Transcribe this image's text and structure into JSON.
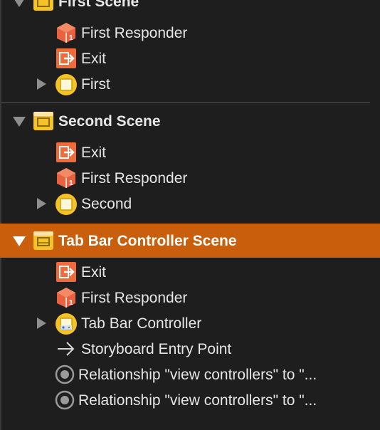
{
  "scenes": [
    {
      "title": "First Scene",
      "items": [
        "First Responder",
        "Exit",
        "First"
      ]
    },
    {
      "title": "Second Scene",
      "items": [
        "Exit",
        "First Responder",
        "Second"
      ]
    },
    {
      "title": "Tab Bar Controller Scene",
      "items": [
        "Exit",
        "First Responder",
        "Tab Bar Controller",
        "Storyboard Entry Point",
        "Relationship \"view controllers\" to \"...",
        "Relationship \"view controllers\" to \"..."
      ]
    }
  ],
  "colors": {
    "background": "#1e1e1e",
    "selected_row": "#c95f0c",
    "scene_icon_yellow": "#f5c228",
    "exit_icon_orange": "#f06b3a",
    "responder_icon_red": "#e8623f"
  }
}
